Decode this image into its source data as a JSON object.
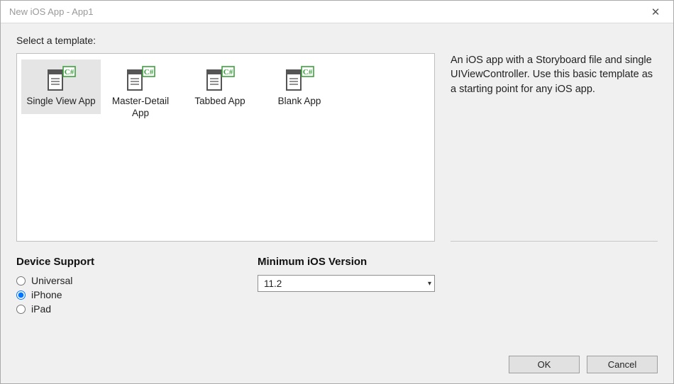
{
  "window": {
    "title": "New iOS App - App1",
    "close_glyph": "✕"
  },
  "prompt": "Select a template:",
  "templates": {
    "items": [
      {
        "label": "Single View App",
        "selected": true
      },
      {
        "label": "Master-Detail App",
        "selected": false
      },
      {
        "label": "Tabbed App",
        "selected": false
      },
      {
        "label": "Blank App",
        "selected": false
      }
    ]
  },
  "description": "An iOS app with a Storyboard file and single UIViewController. Use this basic template as a starting point for any iOS app.",
  "device_support": {
    "header": "Device Support",
    "options": [
      {
        "label": "Universal",
        "checked": false
      },
      {
        "label": "iPhone",
        "checked": true
      },
      {
        "label": "iPad",
        "checked": false
      }
    ]
  },
  "min_version": {
    "header": "Minimum iOS Version",
    "selected": "11.2"
  },
  "buttons": {
    "ok": "OK",
    "cancel": "Cancel"
  }
}
